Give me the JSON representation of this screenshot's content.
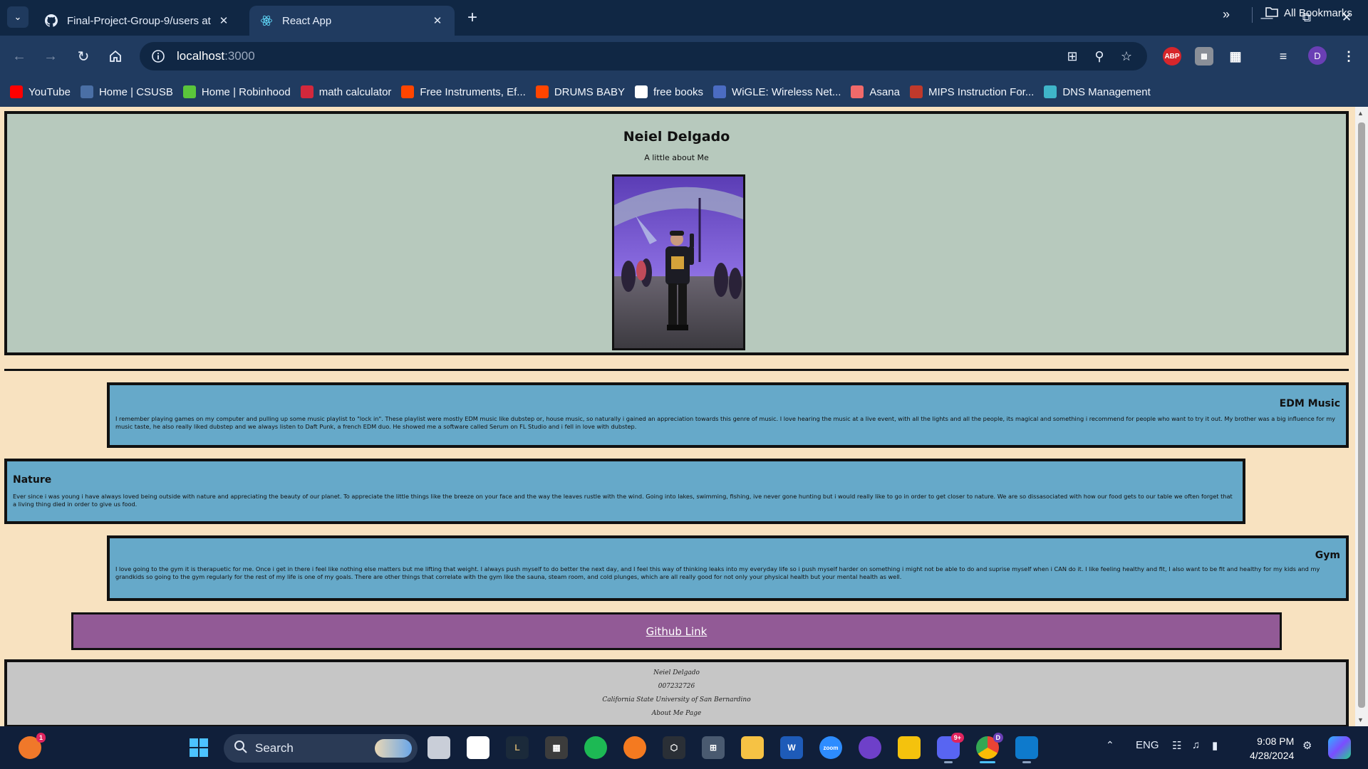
{
  "browser": {
    "tabs": [
      {
        "title": "Final-Project-Group-9/users at",
        "active": false
      },
      {
        "title": "React App",
        "active": true
      }
    ],
    "url_host": "localhost",
    "url_port": ":3000",
    "profile_initial": "D",
    "extensions": [
      "ABP"
    ],
    "bookmarks": [
      {
        "label": "YouTube",
        "icon": "youtube-icon",
        "color": "#ff0000"
      },
      {
        "label": "Home | CSUSB",
        "icon": "csusb-icon",
        "color": "#4a6fa5"
      },
      {
        "label": "Home | Robinhood",
        "icon": "robinhood-icon",
        "color": "#5ac53b"
      },
      {
        "label": "math calculator",
        "icon": "symbolab-icon",
        "color": "#d3283c"
      },
      {
        "label": "Free Instruments, Ef...",
        "icon": "reddit-icon",
        "color": "#ff4500"
      },
      {
        "label": "DRUMS BABY",
        "icon": "reddit-icon",
        "color": "#ff4500"
      },
      {
        "label": "free books",
        "icon": "book-icon",
        "color": "#ffffff"
      },
      {
        "label": "WiGLE: Wireless Net...",
        "icon": "wigle-icon",
        "color": "#4b6cc2"
      },
      {
        "label": "Asana",
        "icon": "asana-icon",
        "color": "#f06a6a"
      },
      {
        "label": "MIPS Instruction For...",
        "icon": "mips-icon",
        "color": "#c0392b"
      },
      {
        "label": "DNS Management",
        "icon": "dns-icon",
        "color": "#3fb5c9"
      }
    ],
    "all_bookmarks_label": "All Bookmarks"
  },
  "page": {
    "hero": {
      "name": "Neiel Delgado",
      "subtitle": "A little about Me"
    },
    "sections": [
      {
        "title": "EDM Music",
        "body": "I remember playing games on my computer and pulling up some music playlist to \"lock in\". These playlist were mostly EDM music like dubstep or, house music, so naturally i gained an appreciation towards this genre of music. I love hearing the music at a live event, with all the lights and all the people, its magical and something i recommend for people who want to try it out. My brother was a big influence for my music taste, he also really liked dubstep and we always listen to Daft Punk, a french EDM duo. He showed me a software called Serum on FL Studio and i fell in love with dubstep."
      },
      {
        "title": "Nature",
        "body": "Ever since i was young i have always loved being outside with nature and appreciating the beauty of our planet. To appreciate the little things like the breeze on your face and the way the leaves rustle with the wind. Going into lakes, swimming, fishing, ive never gone hunting but i would really like to go in order to get closer to nature. We are so dissasociated with how our food gets to our table we often forget that a living thing died in order to give us food."
      },
      {
        "title": "Gym",
        "body": "I love going to the gym it is therapuetic for me. Once i get in there i feel like nothing else matters but me lifting that weight. I always push myself to do better the next day, and I feel this way of thinking leaks into my everyday life so i push myself harder on something i might not be able to do and suprise myself when i CAN do it. I like feeling healthy and fit, I also want to be fit and healthy for my kids and my grandkids so going to the gym regularly for the rest of my life is one of my goals. There are other things that correlate with the gym like the sauna, steam room, and cold plunges, which are all really good for not only your physical health but your mental health as well."
      }
    ],
    "github_link": "Github Link",
    "footer": [
      "Neiel Delgado",
      "007232726",
      "California State University of San Bernardino",
      "About Me Page"
    ]
  },
  "taskbar": {
    "search_placeholder": "Search",
    "notification_count": "1",
    "discord_badge": "9+",
    "chrome_badge": "D",
    "language": "ENG",
    "time": "9:08 PM",
    "date": "4/28/2024"
  },
  "colors": {
    "page_bg": "#f8e2c0",
    "hero_bg": "#b7c9bd",
    "card_bg": "#66a9c9",
    "link_bg": "#925a96",
    "footer_bg": "#c6c6c6"
  }
}
